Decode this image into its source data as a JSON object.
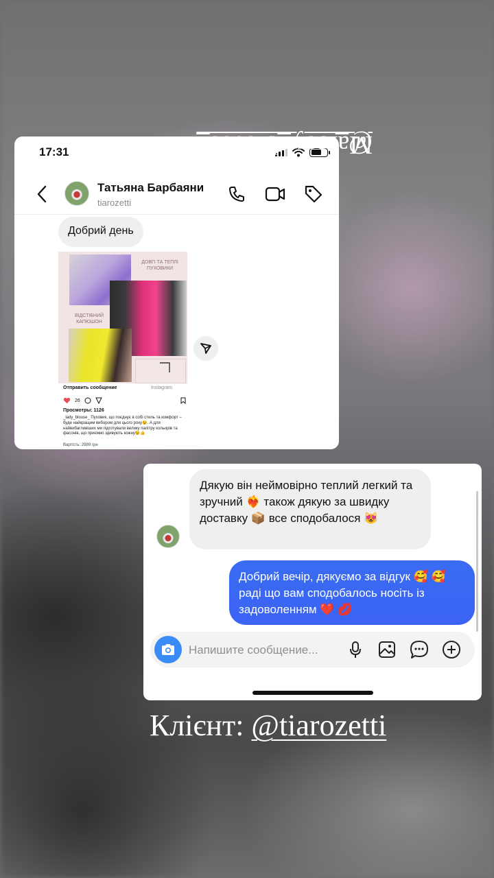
{
  "story": {
    "shop_caption_prefix": "Магазин: ",
    "shop_caption_handle": "@_lady_blouse_",
    "client_caption_prefix": "Клієнт: ",
    "client_caption_handle": "@tiarozetti"
  },
  "screenshot1": {
    "status_time": "17:31",
    "contact_name": "Татьяна Барбаяни",
    "contact_username": "tiarozetti",
    "messages": [
      {
        "direction": "incoming",
        "text": "Добрий день"
      }
    ],
    "shared_post": {
      "collage_title": "ДОВГІ ТА ТЕПЛІ ПУХОВИКИ",
      "collage_hood_label": "ВІДСТІБНИЙ КАПЮШОН",
      "send_label": "Отправить сообщение",
      "source_label": "Instagram",
      "likes": "26",
      "views": "Просмотры: 1126",
      "caption": "_lady_blouse_ Пуховик, що поєднує в собі стиль та комфорт – буде найкращим вибором для цього року😉. А для найвибагливіших ми підготували велику палітру кольорів та фасонів, що приємно здивують кожну😉👍",
      "price": "Вартість: 2989 грн"
    }
  },
  "screenshot2": {
    "messages": [
      {
        "direction": "incoming",
        "text": "Дякую він неймовірно теплий легкий та зручний ❤️‍🔥 також дякую за швидку доставку 📦 все сподобалося 😻"
      },
      {
        "direction": "outgoing",
        "text": "Добрий вечір, дякуємо за відгук 🥰 🥰 раді що вам сподобалось носіть із задоволенням ❤️ 💋"
      }
    ],
    "compose_placeholder": "Напишите сообщение..."
  },
  "colors": {
    "outgoing_bubble": "#3b63f4",
    "incoming_bubble": "#efefef",
    "camera_button": "#3a8bf5",
    "like_heart": "#ed4956"
  },
  "icons": [
    "back-icon",
    "phone-icon",
    "video-icon",
    "tag-icon",
    "send-icon",
    "camera-icon",
    "mic-icon",
    "gallery-icon",
    "sticker-icon",
    "plus-icon"
  ]
}
